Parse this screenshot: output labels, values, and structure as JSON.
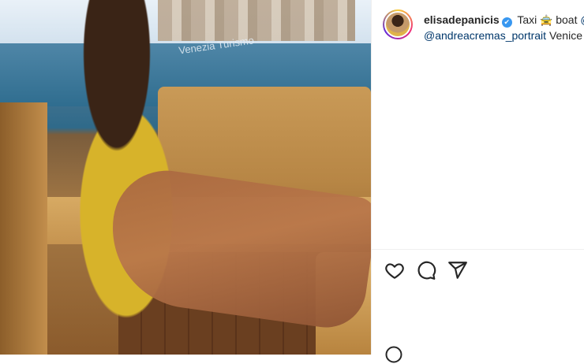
{
  "post": {
    "image_alt": "Woman in yellow dress seated in a Venice water taxi",
    "sign_text": "Venezia Turismo"
  },
  "header": {
    "username": "elisadepanicis",
    "verified_badge": "✔",
    "caption_word1": "Taxi",
    "caption_emoji": "🚖",
    "caption_word2": "boat",
    "caption_mention1": "@_",
    "caption_mention2": "@andreacremas_portrait",
    "caption_tail": "Venice f"
  },
  "actions": {
    "like_icon": "heart-icon",
    "comment_icon": "comment-icon",
    "share_icon": "paper-plane-icon"
  },
  "colors": {
    "link": "#00376b",
    "verified": "#3897f0",
    "text": "#262626"
  }
}
